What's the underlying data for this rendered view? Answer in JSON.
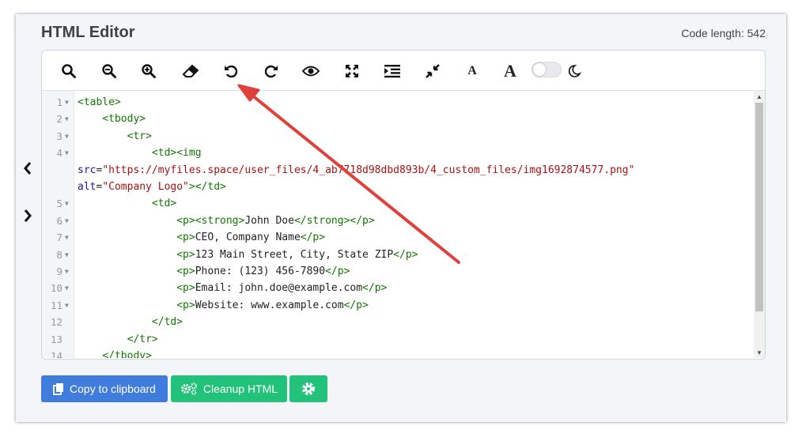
{
  "editor": {
    "title": "HTML Editor",
    "code_length": "Code length: 542"
  },
  "toolbar": {
    "icons": [
      "search-icon",
      "zoom-out-icon",
      "zoom-in-icon",
      "eraser-icon",
      "undo-icon",
      "redo-icon",
      "preview-eye-icon",
      "fullscreen-icon",
      "indent-icon",
      "collapse-icon",
      "font-small-icon",
      "font-large-icon",
      "dark-mode-toggle",
      "moon-icon"
    ],
    "font_small_glyph": "A",
    "font_large_glyph": "A"
  },
  "code": {
    "lines": [
      {
        "n": "1",
        "fold": true,
        "html": "<span class=\"tag\">&lt;table&gt;</span>"
      },
      {
        "n": "2",
        "fold": true,
        "html": "    <span class=\"tag\">&lt;tbody&gt;</span>"
      },
      {
        "n": "3",
        "fold": true,
        "html": "        <span class=\"tag\">&lt;tr&gt;</span>"
      },
      {
        "n": "4",
        "fold": true,
        "html": "            <span class=\"tag\">&lt;td&gt;&lt;img</span>"
      },
      {
        "n": "",
        "fold": false,
        "html": "<span class=\"attr\">src</span>=<span class=\"str\">\"https://myfiles.space/user_files/4_ab7718d98dbd893b/4_custom_files/img1692874577.png\"</span>"
      },
      {
        "n": "",
        "fold": false,
        "html": "<span class=\"attr\">alt</span>=<span class=\"str\">\"Company Logo\"</span><span class=\"tag\">&gt;&lt;/td&gt;</span>"
      },
      {
        "n": "5",
        "fold": true,
        "html": "            <span class=\"tag\">&lt;td&gt;</span>"
      },
      {
        "n": "6",
        "fold": true,
        "html": "                <span class=\"tag\">&lt;p&gt;&lt;strong&gt;</span>John Doe<span class=\"tag\">&lt;/strong&gt;&lt;/p&gt;</span>"
      },
      {
        "n": "7",
        "fold": true,
        "html": "                <span class=\"tag\">&lt;p&gt;</span>CEO, Company Name<span class=\"tag\">&lt;/p&gt;</span>"
      },
      {
        "n": "8",
        "fold": true,
        "html": "                <span class=\"tag\">&lt;p&gt;</span>123 Main Street, City, State ZIP<span class=\"tag\">&lt;/p&gt;</span>"
      },
      {
        "n": "9",
        "fold": true,
        "html": "                <span class=\"tag\">&lt;p&gt;</span>Phone: (123) 456-7890<span class=\"tag\">&lt;/p&gt;</span>"
      },
      {
        "n": "10",
        "fold": true,
        "html": "                <span class=\"tag\">&lt;p&gt;</span>Email: john.doe@example.com<span class=\"tag\">&lt;/p&gt;</span>"
      },
      {
        "n": "11",
        "fold": true,
        "html": "                <span class=\"tag\">&lt;p&gt;</span>Website: www.example.com<span class=\"tag\">&lt;/p&gt;</span>"
      },
      {
        "n": "12",
        "fold": false,
        "html": "            <span class=\"tag\">&lt;/td&gt;</span>"
      },
      {
        "n": "13",
        "fold": false,
        "html": "        <span class=\"tag\">&lt;/tr&gt;</span>"
      },
      {
        "n": "14",
        "fold": false,
        "html": "    <span class=\"tag\">&lt;/tbody&gt;</span>"
      }
    ]
  },
  "buttons": {
    "copy_label": "Copy to clipboard",
    "cleanup_label": "Cleanup HTML"
  },
  "colors": {
    "copy_button": "#3f7cdb",
    "cleanup_button": "#22c27a",
    "annotation_arrow": "#e0403a",
    "tag": "#117700",
    "attribute": "#221199",
    "string": "#aa1111"
  }
}
